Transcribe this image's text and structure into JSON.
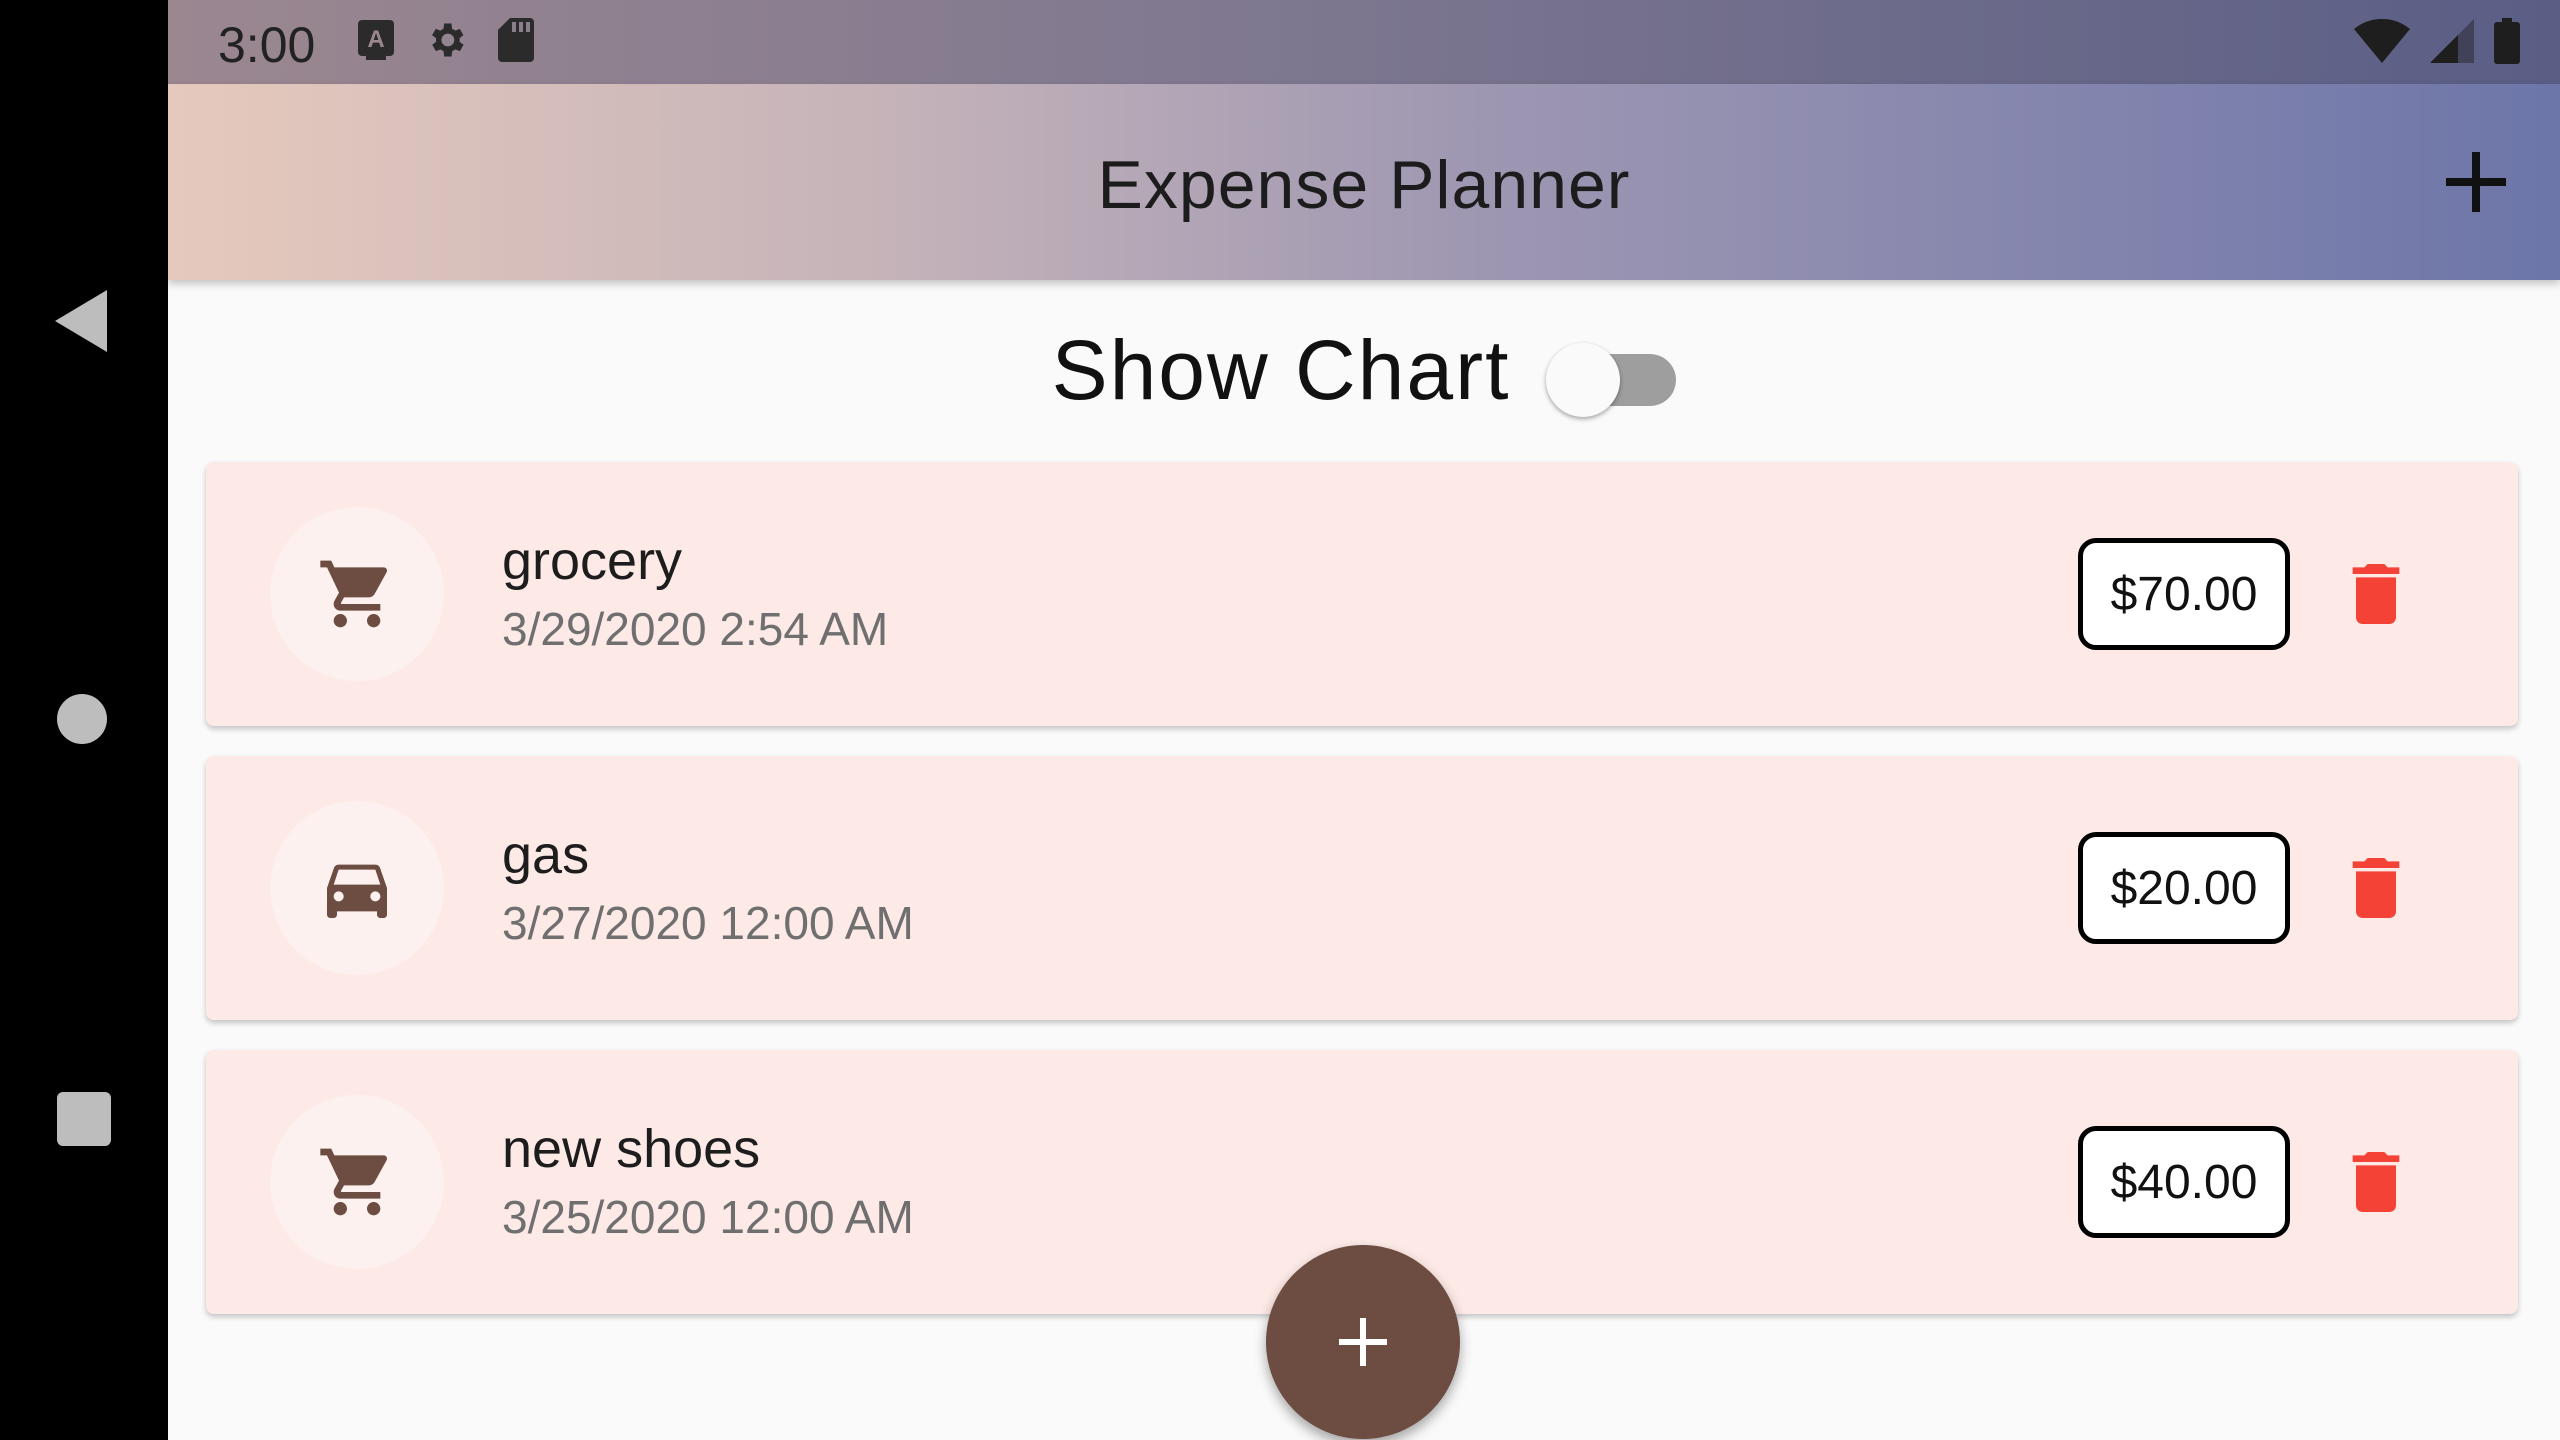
{
  "status_bar": {
    "time": "3:00",
    "left_icons": [
      "a-keyboard-icon",
      "settings-icon",
      "sd-card-icon"
    ],
    "right_icons": [
      "wifi-icon",
      "cellular-signal-icon",
      "battery-icon"
    ]
  },
  "nav_bar": {
    "buttons": [
      "back",
      "home",
      "recents"
    ]
  },
  "app_bar": {
    "title": "Expense Planner",
    "action_icon": "plus-icon"
  },
  "chart_toggle": {
    "label": "Show Chart",
    "on": false
  },
  "expenses": [
    {
      "title": "grocery",
      "date": "3/29/2020 2:54 AM",
      "amount": "$70.00",
      "icon": "cart-icon"
    },
    {
      "title": "gas",
      "date": "3/27/2020 12:00 AM",
      "amount": "$20.00",
      "icon": "car-icon"
    },
    {
      "title": "new shoes",
      "date": "3/25/2020 12:00 AM",
      "amount": "$40.00",
      "icon": "cart-icon"
    }
  ],
  "fab": {
    "icon": "plus-icon"
  },
  "colors": {
    "card_background": "#fdeae7",
    "fab": "#6d4c41",
    "delete": "#f44336",
    "icon_brown": "#6d4c41"
  }
}
